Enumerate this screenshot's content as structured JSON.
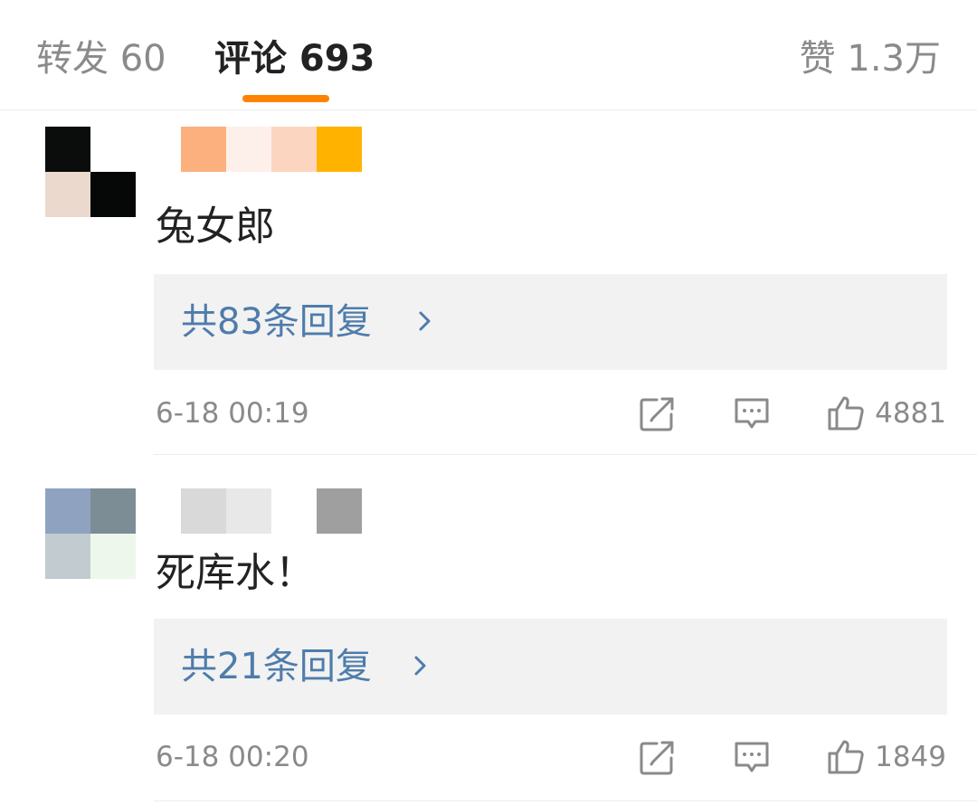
{
  "tabs": {
    "reposts": "转发 60",
    "comments": "评论 693",
    "likes": "赞 1.3万",
    "accent_color": "#ff8200"
  },
  "comments": [
    {
      "avatar_colors": [
        "#0b0d0c",
        "#ffffff",
        "#ead9cc",
        "#050807"
      ],
      "username_colors": [
        "#fbb07d",
        "#fdf0ea",
        "#fcd5c1",
        "#ffb300"
      ],
      "text": "兔女郎",
      "replies_label": "共83条回复",
      "timestamp": "6-18 00:19",
      "like_count": "4881"
    },
    {
      "avatar_colors": [
        "#8fa3c1",
        "#7d8d96",
        "#c2cbcf",
        "#eef7ec"
      ],
      "username_colors": [
        "#d9d9d9",
        "#e8e8e8",
        "#ffffff",
        "#9f9f9f"
      ],
      "text": "死库水！",
      "replies_label": "共21条回复",
      "timestamp": "6-18 00:20",
      "like_count": "1849"
    }
  ],
  "icons": {
    "share": "share-icon",
    "reply": "comment-icon",
    "like": "thumbs-up-icon",
    "chevron": "chevron-right-icon"
  },
  "colors": {
    "link_blue": "#4e7cab",
    "muted_gray": "#8a8a8a",
    "reply_box_bg": "#f2f2f2"
  }
}
